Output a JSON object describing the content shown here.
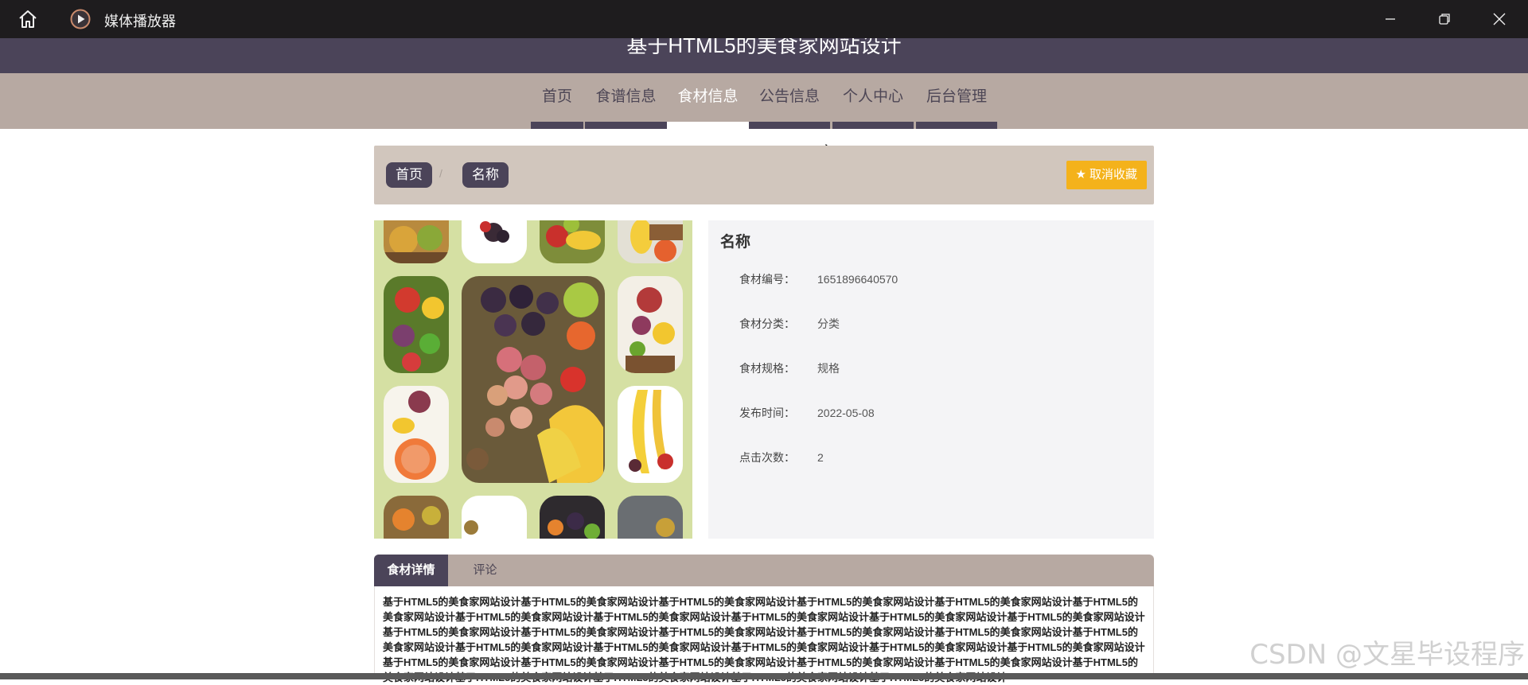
{
  "window": {
    "app_title": "媒体播放器"
  },
  "site": {
    "title": "基于HTML5的美食家网站设计"
  },
  "nav": {
    "items": [
      {
        "label": "首页"
      },
      {
        "label": "食谱信息"
      },
      {
        "label": "食材信息",
        "active": true
      },
      {
        "label": "公告信息"
      },
      {
        "label": "个人中心"
      },
      {
        "label": "后台管理"
      }
    ]
  },
  "breadcrumb": {
    "home": "首页",
    "separator": "/",
    "current": "名称"
  },
  "favorite": {
    "label": "取消收藏"
  },
  "info": {
    "title": "名称",
    "rows": [
      {
        "label": "食材编号：",
        "value": "1651896640570"
      },
      {
        "label": "食材分类：",
        "value": "分类"
      },
      {
        "label": "食材规格：",
        "value": "规格"
      },
      {
        "label": "发布时间：",
        "value": "2022-05-08"
      },
      {
        "label": "点击次数：",
        "value": "2"
      }
    ]
  },
  "tabs": {
    "items": [
      {
        "label": "食材详情",
        "active": true
      },
      {
        "label": "评论"
      }
    ],
    "content": "基于HTML5的美食家网站设计基于HTML5的美食家网站设计基于HTML5的美食家网站设计基于HTML5的美食家网站设计基于HTML5的美食家网站设计基于HTML5的美食家网站设计基于HTML5的美食家网站设计基于HTML5的美食家网站设计基于HTML5的美食家网站设计基于HTML5的美食家网站设计基于HTML5的美食家网站设计基于HTML5的美食家网站设计基于HTML5的美食家网站设计基于HTML5的美食家网站设计基于HTML5的美食家网站设计基于HTML5的美食家网站设计基于HTML5的美食家网站设计基于HTML5的美食家网站设计基于HTML5的美食家网站设计基于HTML5的美食家网站设计基于HTML5的美食家网站设计基于HTML5的美食家网站设计基于HTML5的美食家网站设计基于HTML5的美食家网站设计基于HTML5的美食家网站设计基于HTML5的美食家网站设计基于HTML5的美食家网站设计基于HTML5的美食家网站设计基于HTML5的美食家网站设计基于HTML5的美食家网站设计基于HTML5的美食家网站设计基于HTML5的美食家网站设计"
  },
  "watermark": "CSDN @文星毕设程序",
  "colors": {
    "header": "#4b4459",
    "nav": "#b7a9a2",
    "breadcrumb_bar": "#d1c6bd",
    "favorite": "#f4b21b",
    "image_background": "#d5e0a3",
    "info_panel": "#f4f4f6"
  },
  "icons": {
    "home": "home-icon",
    "app": "play-circle-icon",
    "minimize": "minimize-icon",
    "maximize": "restore-icon",
    "close": "close-icon",
    "favorite": "star-icon"
  }
}
